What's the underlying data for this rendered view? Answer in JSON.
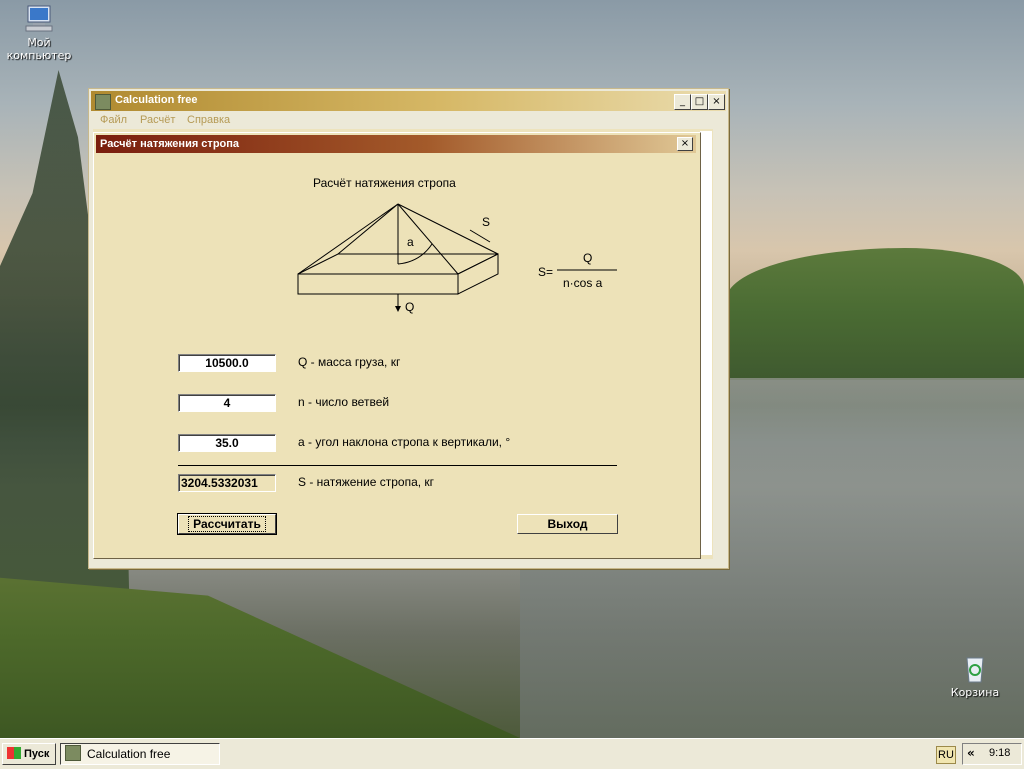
{
  "desktop": {
    "icons": [
      {
        "label_line1": "Мой",
        "label_line2": "компьютер",
        "icon": "my-computer-icon"
      },
      {
        "label_line1": "Корзина",
        "label_line2": "",
        "icon": "recycle-bin-icon"
      }
    ]
  },
  "window": {
    "title": "Calculation free",
    "controls": {
      "minimize": "_",
      "maximize": "□",
      "close": "×"
    },
    "menu": [
      "Файл",
      "Расчёт",
      "Справка"
    ]
  },
  "dialog": {
    "title": "Расчёт натяжения стропа",
    "diagram": {
      "heading": "Расчёт натяжения стропа",
      "label_s": "S",
      "label_a": "a",
      "label_q": "Q",
      "formula_lhs": "S=",
      "formula_num": "Q",
      "formula_den": "n·cos a"
    },
    "fields": [
      {
        "value": "10500.0",
        "label": "Q - масса груза, кг"
      },
      {
        "value": "4",
        "label": "n - число ветвей"
      },
      {
        "value": "35.0",
        "label": "a - угол наклона стропа к вертикали, °"
      }
    ],
    "result": {
      "value": "3204.5332031",
      "label": "S - натяжение стропа, кг"
    },
    "buttons": {
      "calculate": "Рассчитать",
      "exit": "Выход"
    }
  },
  "taskbar": {
    "start": "Пуск",
    "task": "Calculation free",
    "lang": "RU",
    "chevron": "«",
    "clock": "9:18"
  }
}
